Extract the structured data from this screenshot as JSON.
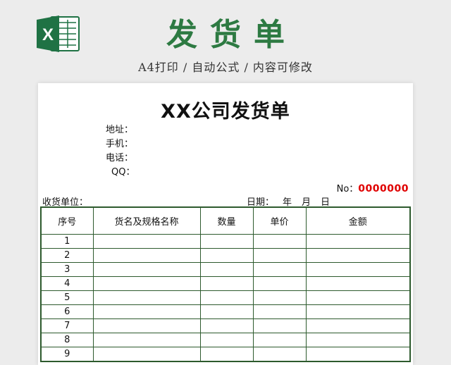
{
  "banner": {
    "title": "发货单",
    "subtitle": "A4打印 / 自动公式 / 内容可修改",
    "logo_icon": "excel-logo-icon",
    "logo_letter": "X",
    "brand_color": "#1f7244"
  },
  "document": {
    "title": "XX公司发货单",
    "info_lines": [
      "地址：",
      "手机：",
      "电话：",
      "QQ："
    ],
    "no_label": "No：",
    "no_value": "0000000",
    "receiver_label": "收货单位：",
    "date_label": "日期：",
    "date_year": "年",
    "date_month": "月",
    "date_day": "日",
    "accent_red": "#e00000",
    "grid_color": "#2d5a2d"
  },
  "table": {
    "headers": [
      "序号",
      "货名及规格名称",
      "数量",
      "单价",
      "金额"
    ],
    "rows": [
      {
        "index": "1",
        "name": "",
        "qty": "",
        "price": "",
        "amount": ""
      },
      {
        "index": "2",
        "name": "",
        "qty": "",
        "price": "",
        "amount": ""
      },
      {
        "index": "3",
        "name": "",
        "qty": "",
        "price": "",
        "amount": ""
      },
      {
        "index": "4",
        "name": "",
        "qty": "",
        "price": "",
        "amount": ""
      },
      {
        "index": "5",
        "name": "",
        "qty": "",
        "price": "",
        "amount": ""
      },
      {
        "index": "6",
        "name": "",
        "qty": "",
        "price": "",
        "amount": ""
      },
      {
        "index": "7",
        "name": "",
        "qty": "",
        "price": "",
        "amount": ""
      },
      {
        "index": "8",
        "name": "",
        "qty": "",
        "price": "",
        "amount": ""
      },
      {
        "index": "9",
        "name": "",
        "qty": "",
        "price": "",
        "amount": ""
      }
    ]
  }
}
